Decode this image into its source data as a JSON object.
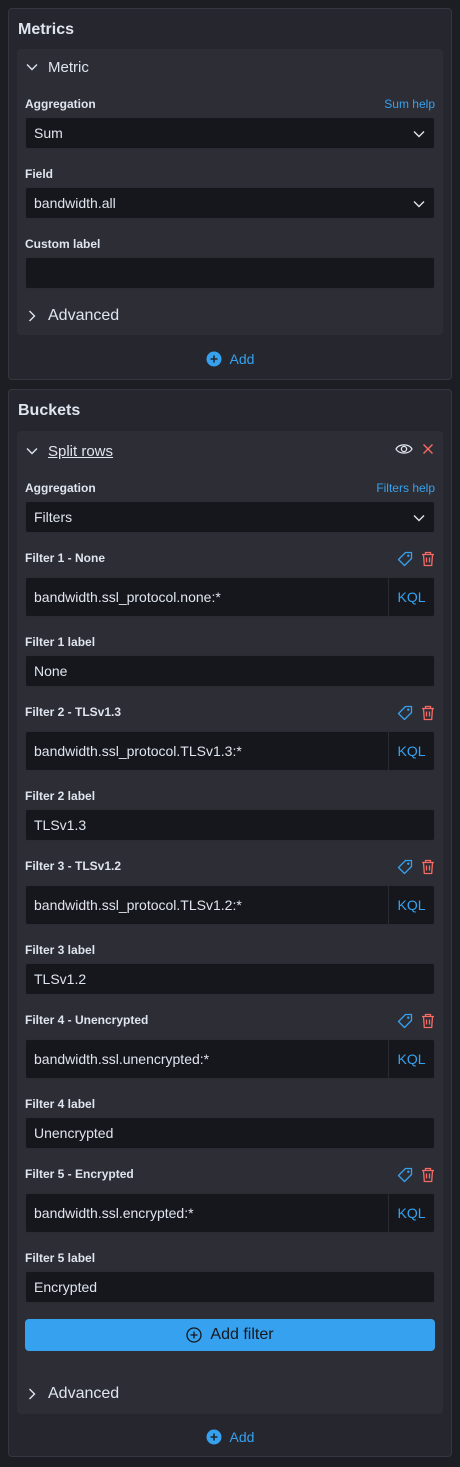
{
  "metrics": {
    "title": "Metrics",
    "metric_header": "Metric",
    "aggregation_label": "Aggregation",
    "aggregation_help": "Sum help",
    "aggregation_value": "Sum",
    "field_label": "Field",
    "field_value": "bandwidth.all",
    "custom_label_label": "Custom label",
    "custom_label_value": "",
    "advanced_label": "Advanced",
    "add_label": "Add"
  },
  "buckets": {
    "title": "Buckets",
    "split_header": "Split rows",
    "aggregation_label": "Aggregation",
    "aggregation_help": "Filters help",
    "aggregation_value": "Filters",
    "kql_label": "KQL",
    "filters": [
      {
        "title": "Filter 1 - None",
        "query": "bandwidth.ssl_protocol.none:*",
        "label_title": "Filter 1 label",
        "label_value": "None"
      },
      {
        "title": "Filter 2 - TLSv1.3",
        "query": "bandwidth.ssl_protocol.TLSv1.3:*",
        "label_title": "Filter 2 label",
        "label_value": "TLSv1.3"
      },
      {
        "title": "Filter 3 - TLSv1.2",
        "query": "bandwidth.ssl_protocol.TLSv1.2:*",
        "label_title": "Filter 3 label",
        "label_value": "TLSv1.2"
      },
      {
        "title": "Filter 4 - Unencrypted",
        "query": "bandwidth.ssl.unencrypted:*",
        "label_title": "Filter 4 label",
        "label_value": "Unencrypted"
      },
      {
        "title": "Filter 5 - Encrypted",
        "query": "bandwidth.ssl.encrypted:*",
        "label_title": "Filter 5 label",
        "label_value": "Encrypted"
      }
    ],
    "add_filter_label": "Add filter",
    "advanced_label": "Advanced",
    "add_label": "Add"
  },
  "colors": {
    "accent": "#36a2ef",
    "danger": "#f86b63",
    "background": "#1d1e24",
    "panel": "#25262e"
  },
  "icons": {
    "collapse": "chevron-down-icon",
    "expand": "chevron-right-icon",
    "add": "plus-circle-icon",
    "visibility": "eye-icon",
    "remove": "cross-icon",
    "tag": "tag-icon",
    "delete": "trash-icon"
  }
}
